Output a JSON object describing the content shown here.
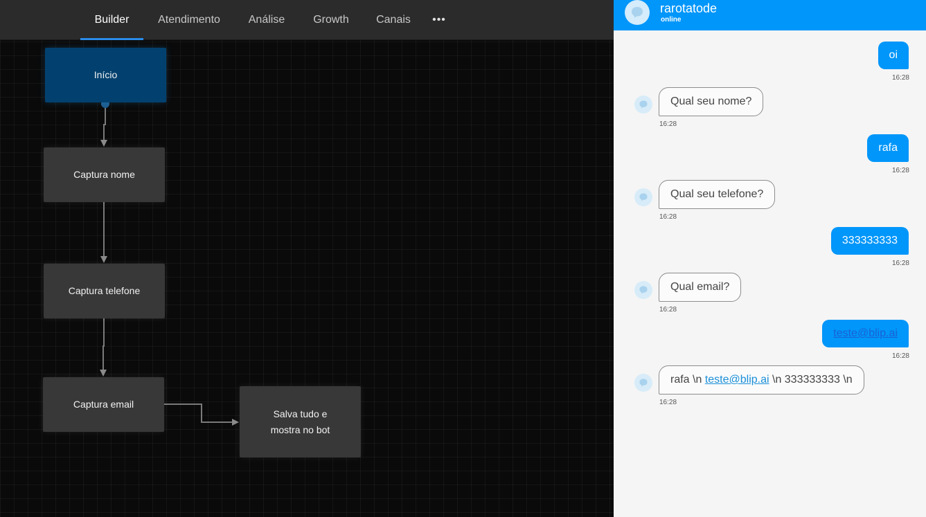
{
  "nav": {
    "tabs": [
      {
        "label": "Builder",
        "active": true
      },
      {
        "label": "Atendimento",
        "active": false
      },
      {
        "label": "Análise",
        "active": false
      },
      {
        "label": "Growth",
        "active": false
      },
      {
        "label": "Canais",
        "active": false
      }
    ],
    "more_label": "•••"
  },
  "flow": {
    "nodes": {
      "inicio": "Início",
      "captura_nome": "Captura nome",
      "captura_telefone": "Captura telefone",
      "captura_email": "Captura email",
      "salva_tudo": "Salva tudo e mostra no bot"
    }
  },
  "chat": {
    "bot_name": "rarotatode",
    "status": "online",
    "messages": [
      {
        "from": "user",
        "text": "oi",
        "time": "16:28"
      },
      {
        "from": "bot",
        "text": "Qual seu nome?",
        "time": "16:28"
      },
      {
        "from": "user",
        "text": "rafa",
        "time": "16:28"
      },
      {
        "from": "bot",
        "text": "Qual seu telefone?",
        "time": "16:28"
      },
      {
        "from": "user",
        "text": "333333333",
        "time": "16:28"
      },
      {
        "from": "bot",
        "text": "Qual email?",
        "time": "16:28"
      },
      {
        "from": "user",
        "text": "teste@blip.ai",
        "time": "16:28"
      },
      {
        "from": "bot",
        "text_before": "rafa \\n ",
        "link": "teste@blip.ai",
        "text_after": " \\n 333333333 \\n",
        "time": "16:28"
      }
    ]
  },
  "colors": {
    "accent": "#0096fa",
    "start_node": "#02416f",
    "node": "#383838",
    "active_tab_underline": "#2a8be8"
  }
}
